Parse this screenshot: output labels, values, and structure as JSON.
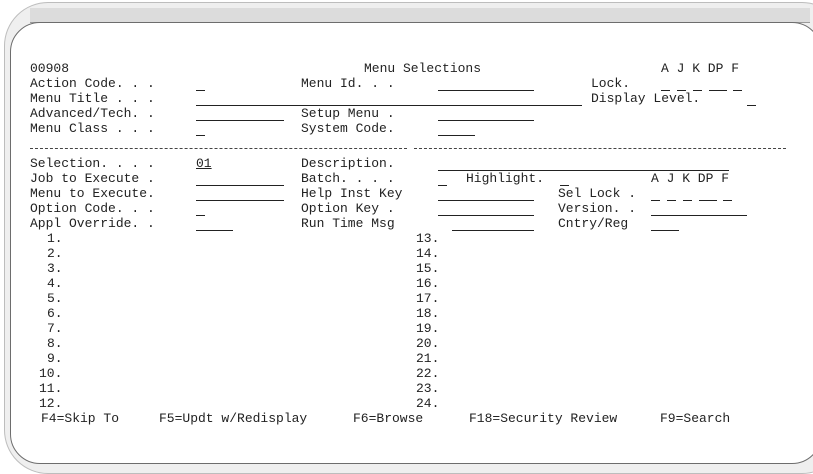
{
  "header": {
    "program_id": "00908",
    "title": "Menu Selections",
    "flag_legend": "A J K DP F"
  },
  "fields": {
    "action_code_label": "Action Code. . .",
    "menu_id_label": "Menu Id. . .",
    "lock_label": "Lock.",
    "menu_title_label": "Menu Title . . .",
    "display_level_label": "Display Level.",
    "advanced_tech_label": "Advanced/Tech. .",
    "setup_menu_label": "Setup Menu .",
    "menu_class_label": "Menu Class . . .",
    "system_code_label": "System Code."
  },
  "detail": {
    "selection_label": "Selection. . . .",
    "selection_value": "01",
    "description_label": "Description.",
    "job_to_execute_label": "Job to Execute .",
    "batch_label": "Batch. . . .",
    "highlight_label": "Highlight.",
    "flag_legend": "A J K DP F",
    "menu_to_execute_label": "Menu to Execute.",
    "help_inst_key_label": "Help Inst Key",
    "sel_lock_label": "Sel Lock .",
    "option_code_label": "Option Code. . .",
    "option_key_label": "Option Key .",
    "version_label": "Version. .",
    "appl_override_label": "Appl Override. .",
    "run_time_msg_label": "Run Time Msg",
    "cntry_reg_label": "Cntry/Reg"
  },
  "selection_numbers_left": [
    "1.",
    "2.",
    "3.",
    "4.",
    "5.",
    "6.",
    "7.",
    "8.",
    "9.",
    "10.",
    "11.",
    "12."
  ],
  "selection_numbers_right": [
    "13.",
    "14.",
    "15.",
    "16.",
    "17.",
    "18.",
    "19.",
    "20.",
    "21.",
    "22.",
    "23.",
    "24."
  ],
  "function_keys": {
    "f4": "F4=Skip To",
    "f5": "F5=Updt w/Redisplay",
    "f6": "F6=Browse",
    "f18": "F18=Security Review",
    "f9": "F9=Search"
  }
}
